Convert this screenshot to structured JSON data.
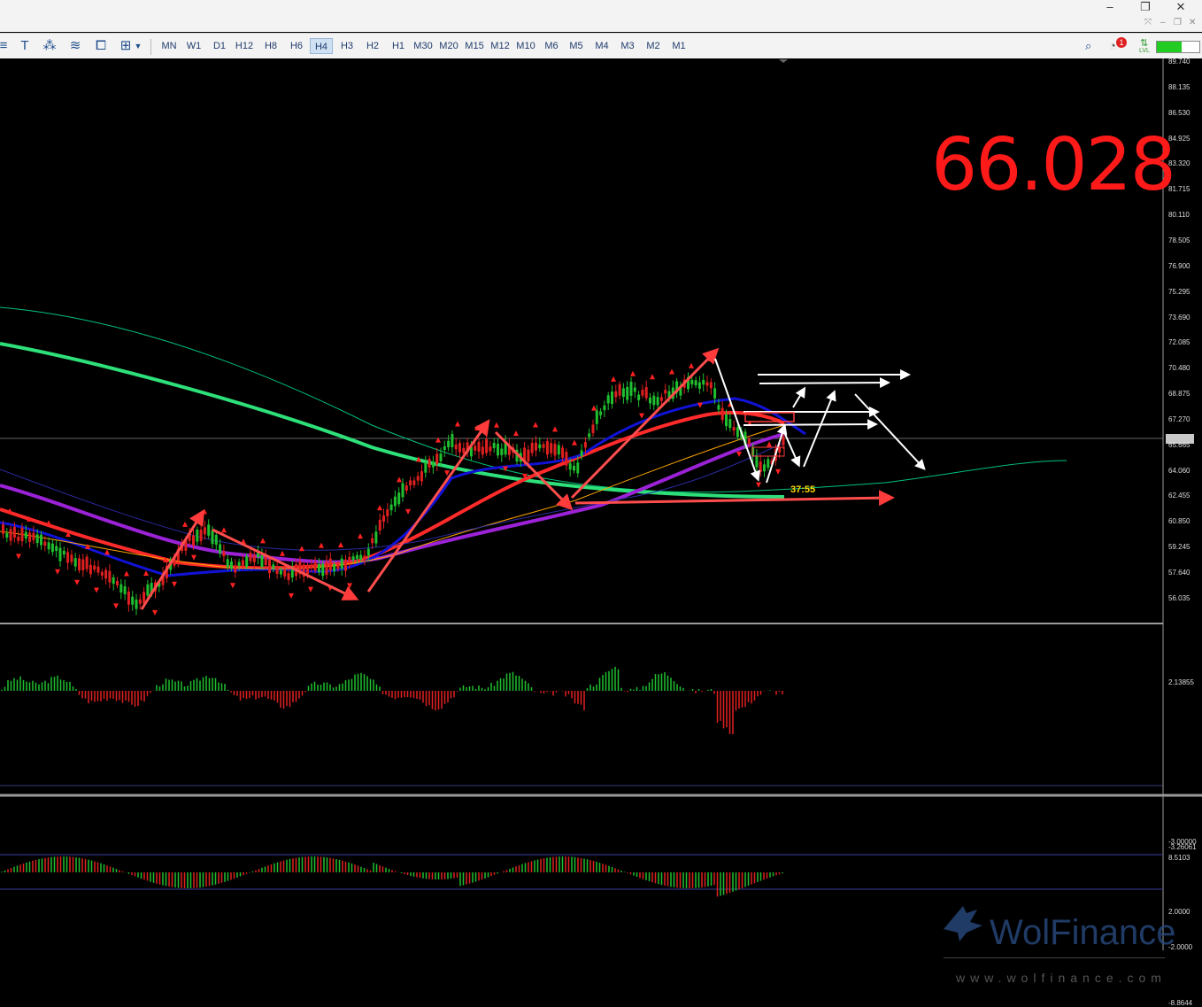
{
  "window": {
    "minimize": "–",
    "restore": "❐",
    "close": "✕",
    "sub_minimize": "–",
    "sub_restore": "❐",
    "sub_close": "✕"
  },
  "toolbar": {
    "timeframes": [
      "MN",
      "W1",
      "D1",
      "H12",
      "H8",
      "H6",
      "H4",
      "H3",
      "H2",
      "H1",
      "M30",
      "M20",
      "M15",
      "M12",
      "M10",
      "M6",
      "M5",
      "M4",
      "M3",
      "M2",
      "M1"
    ],
    "active_timeframe": "H4",
    "notification_count": "1",
    "lvl_label": "LVL"
  },
  "price": {
    "current": "66.028",
    "big_display": "66.028",
    "bar_timer": "37:55"
  },
  "price_axis": [
    "89.740",
    "88.135",
    "86.530",
    "84.925",
    "83.320",
    "81.715",
    "80.110",
    "78.505",
    "76.900",
    "75.295",
    "73.690",
    "72.085",
    "70.480",
    "68.875",
    "67.270",
    "65.665",
    "64.060",
    "62.455",
    "60.850",
    "59.245",
    "57.640",
    "56.035"
  ],
  "indicator1_axis": {
    "top": "2.13855",
    "bottom": "-3.00000",
    "bottom2": "-3.26061"
  },
  "indicator2_axis": {
    "top": "8.5103",
    "upper": "2.0000",
    "lower": "-2.0000",
    "bottom": "-8.8644"
  },
  "watermark": {
    "brand": "WolFinance",
    "url": "www.wolfinance.com"
  },
  "chart_data": {
    "type": "candlestick",
    "symbol_price": 66.028,
    "ylim": [
      55.0,
      90.5
    ],
    "note_levels": {
      "resistance_arrows": [
        70.48,
        69.9,
        67.6,
        66.8
      ],
      "support_arrow": 62.3
    }
  }
}
